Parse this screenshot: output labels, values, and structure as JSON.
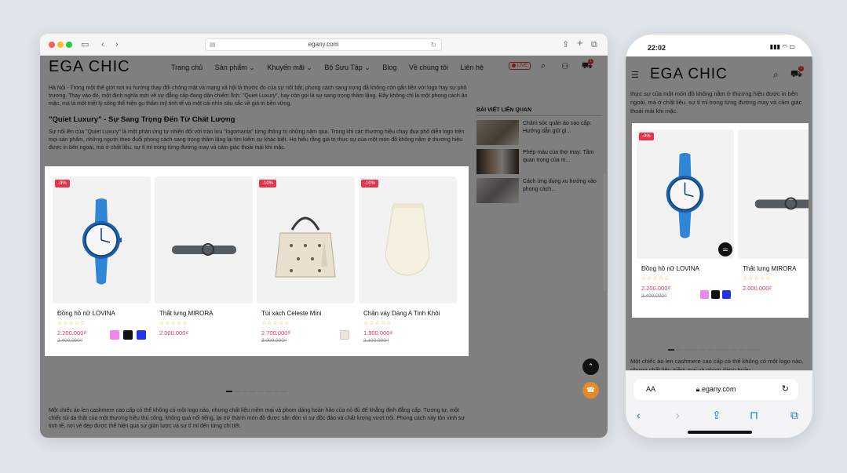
{
  "desktop": {
    "url": "egany.com",
    "logo": "EGA CHIC",
    "menu": [
      "Trang chủ",
      "Sản phẩm ⌄",
      "Khuyến mãi ⌄",
      "Bộ Sưu Tập ⌄",
      "Blog",
      "Về chúng tôi",
      "Liên hệ"
    ],
    "live": "LIVE",
    "cart_count": "1",
    "article_p1": "Hà Nội - Trong một thế giới nơi xu hướng thay đổi chóng mặt và mạng xã hội là thước đo của sự nổi bật, phong cách sang trọng đã không còn gắn liền với logo hay sự phô trương. Thay vào đó, một định nghĩa mới về sự đẳng cấp đang dần chiếm lĩnh: \"Quiet Luxury\", hay còn gọi là sự sang trọng thầm lặng. Đây không chỉ là một phong cách ăn mặc, mà là một triết lý sống thể hiện gu thẩm mỹ tinh tế và một cái nhìn sâu sắc về giá trị bền vững.",
    "article_h2": "\"Quiet Luxury\" - Sự Sang Trọng Đến Từ Chất Lượng",
    "article_p2": "Sự nổi lên của \"Quiet Luxury\" là một phản ứng tự nhiên đối với trào lưu \"logomania\" từng thống trị những năm qua. Trong khi các thương hiệu chạy đua phô diễn logo trên mọi sản phẩm, những người theo đuổi phong cách sang trọng thầm lặng lại tìm kiếm sự khác biệt. Họ hiểu rằng giá trị thực sự của một món đồ không nằm ở thương hiệu được in bên ngoài, mà ở chất liệu, sự tỉ mỉ trong từng đường may và cảm giác thoải mái khi mặc.",
    "sidebar_title": "BÀI VIẾT LIÊN QUAN",
    "sidebar_items": [
      "Chăm sóc quần áo cao cấp: Hướng dẫn giữ gì...",
      "Phép màu của thợ may: Tầm quan trọng của m...",
      "Cách ứng dụng xu hướng vào phong cách..."
    ],
    "bottom_text": "Một chiếc áo len cashmere cao cấp có thể không có một logo nào, nhưng chất liệu mềm mại và phom dáng hoàn hảo của nó đủ để khẳng định đẳng cấp. Tương tự, một chiếc túi da thật của một thương hiệu thủ công, không quá nổi tiếng, lại trở thành món đồ được săn đón vì sự độc đáo và chất lượng vượt trội. Phong cách này tôn vinh sự tinh tế, nơi vẻ đẹp được thể hiện qua sự giản lược và sự tỉ mỉ đến từng chi tiết.",
    "products": [
      {
        "name": "Đồng hồ nữ LOVINA",
        "discount": "-9%",
        "price": "2.200.000₫",
        "old_price": "2.400.000₫",
        "stars": "☆☆☆☆☆"
      },
      {
        "name": "Thắt lưng MIRORA",
        "discount": "",
        "price": "2.000.000₫",
        "old_price": "",
        "stars": "☆☆☆☆☆"
      },
      {
        "name": "Túi xách Celeste Mini",
        "discount": "-10%",
        "price": "2.700.000₫",
        "old_price": "3.000.000₫",
        "stars": "☆☆☆☆☆"
      },
      {
        "name": "Chân váy Dáng A Tinh Khôi",
        "discount": "-10%",
        "price": "1.900.000₫",
        "old_price": "2.100.000₫",
        "stars": "☆☆☆☆☆"
      }
    ]
  },
  "mobile": {
    "time": "22:02",
    "logo": "EGA CHIC",
    "cart_count": "1",
    "text_top": "thực sự của một món đồ không nằm ở thương hiệu được in bên ngoài, mà ở chất liệu, sự tỉ mỉ trong từng đường may và cảm giác thoải mái khi mặc.",
    "text_bottom": "Một chiếc áo len cashmere cao cấp có thể không có một logo nào, nhưng chất liệu mềm mại và phom dáng hoàn",
    "url": "egany.com",
    "aa": "AA",
    "products": [
      {
        "name": "Đồng hồ nữ LOVINA",
        "discount": "-9%",
        "price": "2.200.000₫",
        "old_price": "2.400.000₫",
        "stars": "☆☆☆☆☆"
      },
      {
        "name": "Thắt lưng MIRORA",
        "price": "2.000.000₫",
        "stars": "☆☆☆☆☆"
      }
    ]
  },
  "colors": {
    "accent": "#e8334a",
    "watch_blue": "#2f86d6",
    "swatch_pink": "#ee88ee",
    "swatch_black": "#111111",
    "swatch_blue": "#2233ee"
  }
}
